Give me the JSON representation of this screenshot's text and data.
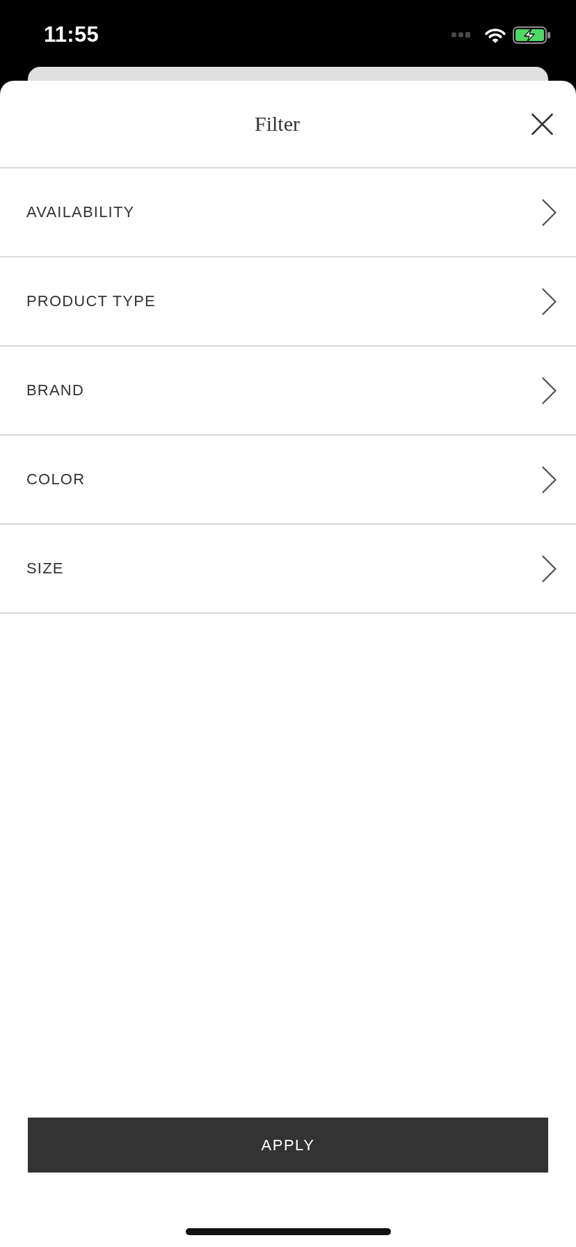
{
  "status_bar": {
    "time": "11:55"
  },
  "sheet": {
    "title": "Filter"
  },
  "filters": [
    {
      "label": "AVAILABILITY"
    },
    {
      "label": "PRODUCT TYPE"
    },
    {
      "label": "BRAND"
    },
    {
      "label": "COLOR"
    },
    {
      "label": "SIZE"
    }
  ],
  "apply_button": {
    "label": "APPLY"
  }
}
